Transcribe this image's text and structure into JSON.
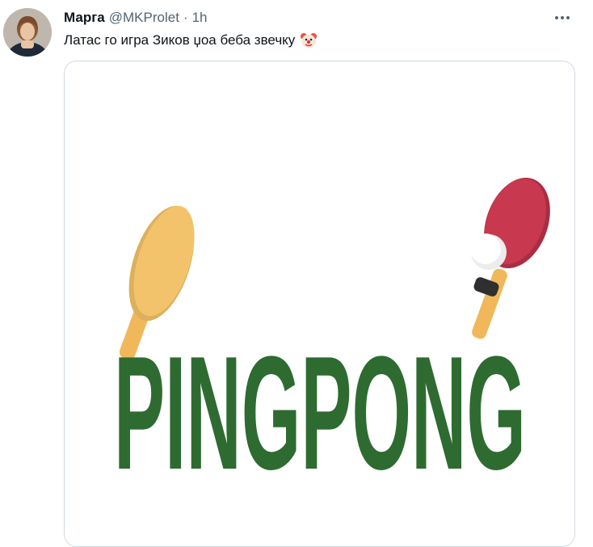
{
  "tweet": {
    "display_name": "Марга",
    "handle": "@MKProlet",
    "separator": "·",
    "time": "1h",
    "text": "Латас го игра Зиков џоа беба звечку",
    "emoji": "clown-face-icon"
  },
  "media": {
    "caption_text": "PINGPONG",
    "colors": {
      "text_green": "#2e6b30",
      "paddle_left": "#f2c36b",
      "paddle_right": "#c8384f",
      "handle": "#f0b85a",
      "ball": "#ffffff"
    }
  },
  "ui": {
    "more_icon": "more-horizontal-icon",
    "border_color": "#cfd9de",
    "secondary_text": "#536471"
  }
}
